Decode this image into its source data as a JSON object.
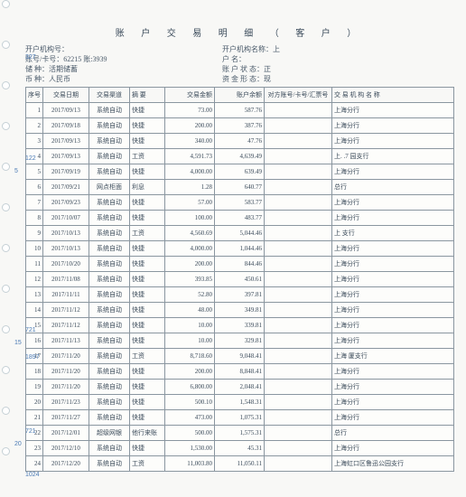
{
  "title": "账 户 交 易 明 细 （ 客 户 ）",
  "header": {
    "left": {
      "l1": "开户机构号：",
      "l2": "账号/卡号：62215          账:3939",
      "l3": "储     种：活期储蓄",
      "l4": "币     种：人民币"
    },
    "right": {
      "r1": "开户机构名称：上",
      "r2": "户         名：",
      "r3": "账 户 状 态：正",
      "r4": "资 金 形 态：现"
    }
  },
  "blue_marks": [
    "327",
    "122",
    "5",
    "721",
    "15",
    "1897",
    "721",
    "20",
    "1024"
  ],
  "columns": {
    "idx": "序号",
    "date": "交易日期",
    "qd": "交易渠道",
    "zy": "摘  要",
    "amt": "交易金额",
    "bal": "账户余额",
    "opp": "对方账号/卡号/汇票号",
    "branch": "交 易 机 构 名 称"
  },
  "rows": [
    {
      "i": "1",
      "d": "2017/09/13",
      "q": "系统自动",
      "z": "快捷",
      "a": "73.00",
      "b": "587.76",
      "o": "",
      "br": "上海分行"
    },
    {
      "i": "2",
      "d": "2017/09/18",
      "q": "系统自动",
      "z": "快捷",
      "a": "200.00",
      "b": "387.76",
      "o": "",
      "br": "上海分行"
    },
    {
      "i": "3",
      "d": "2017/09/13",
      "q": "系统自动",
      "z": "快捷",
      "a": "340.00",
      "b": "47.76",
      "o": "",
      "br": "上海分行"
    },
    {
      "i": "4",
      "d": "2017/09/13",
      "q": "系统自动",
      "z": "工资",
      "a": "4,591.73",
      "b": "4,639.49",
      "o": "",
      "br": "上.      .7  园支行"
    },
    {
      "i": "5",
      "d": "2017/09/19",
      "q": "系统自动",
      "z": "快捷",
      "a": "4,000.00",
      "b": "639.49",
      "o": "",
      "br": "上海分行"
    },
    {
      "i": "6",
      "d": "2017/09/21",
      "q": "网点柜面",
      "z": "利息",
      "a": "1.28",
      "b": "640.77",
      "o": "",
      "br": "总行"
    },
    {
      "i": "7",
      "d": "2017/09/23",
      "q": "系统自动",
      "z": "快捷",
      "a": "57.00",
      "b": "583.77",
      "o": "",
      "br": "上海分行"
    },
    {
      "i": "8",
      "d": "2017/10/07",
      "q": "系统自动",
      "z": "快捷",
      "a": "100.00",
      "b": "483.77",
      "o": "",
      "br": "上海分行"
    },
    {
      "i": "9",
      "d": "2017/10/13",
      "q": "系统自动",
      "z": "工资",
      "a": "4,560.69",
      "b": "5,044.46",
      "o": "",
      "br": "上           支行"
    },
    {
      "i": "10",
      "d": "2017/10/13",
      "q": "系统自动",
      "z": "快捷",
      "a": "4,000.00",
      "b": "1,044.46",
      "o": "",
      "br": "上海分行"
    },
    {
      "i": "11",
      "d": "2017/10/20",
      "q": "系统自动",
      "z": "快捷",
      "a": "200.00",
      "b": "844.46",
      "o": "",
      "br": "上海分行"
    },
    {
      "i": "12",
      "d": "2017/11/08",
      "q": "系统自动",
      "z": "快捷",
      "a": "393.85",
      "b": "450.61",
      "o": "",
      "br": "上海分行"
    },
    {
      "i": "13",
      "d": "2017/11/11",
      "q": "系统自动",
      "z": "快捷",
      "a": "52.80",
      "b": "397.81",
      "o": "",
      "br": "上海分行"
    },
    {
      "i": "14",
      "d": "2017/11/12",
      "q": "系统自动",
      "z": "快捷",
      "a": "48.00",
      "b": "349.81",
      "o": "",
      "br": "上海分行"
    },
    {
      "i": "15",
      "d": "2017/11/12",
      "q": "系统自动",
      "z": "快捷",
      "a": "10.00",
      "b": "339.81",
      "o": "",
      "br": "上海分行"
    },
    {
      "i": "16",
      "d": "2017/11/13",
      "q": "系统自动",
      "z": "快捷",
      "a": "10.00",
      "b": "329.81",
      "o": "",
      "br": "上海分行"
    },
    {
      "i": "17",
      "d": "2017/11/20",
      "q": "系统自动",
      "z": "工资",
      "a": "8,718.60",
      "b": "9,048.41",
      "o": "",
      "br": "上海        厦支行"
    },
    {
      "i": "18",
      "d": "2017/11/20",
      "q": "系统自动",
      "z": "快捷",
      "a": "200.00",
      "b": "8,848.41",
      "o": "",
      "br": "上海分行"
    },
    {
      "i": "19",
      "d": "2017/11/20",
      "q": "系统自动",
      "z": "快捷",
      "a": "6,800.00",
      "b": "2,048.41",
      "o": "",
      "br": "上海分行"
    },
    {
      "i": "20",
      "d": "2017/11/23",
      "q": "系统自动",
      "z": "快捷",
      "a": "500.10",
      "b": "1,548.31",
      "o": "",
      "br": "上海分行"
    },
    {
      "i": "21",
      "d": "2017/11/27",
      "q": "系统自动",
      "z": "快捷",
      "a": "473.00",
      "b": "1,075.31",
      "o": "",
      "br": "上海分行"
    },
    {
      "i": "22",
      "d": "2017/12/01",
      "q": "超级网银",
      "z": "他行来账",
      "a": "500.00",
      "b": "1,575.31",
      "o": "",
      "br": "总行"
    },
    {
      "i": "23",
      "d": "2017/12/10",
      "q": "系统自动",
      "z": "快捷",
      "a": "1,530.00",
      "b": "45.31",
      "o": "",
      "br": "上海分行"
    },
    {
      "i": "24",
      "d": "2017/12/20",
      "q": "系统自动",
      "z": "工资",
      "a": "11,003.80",
      "b": "11,050.11",
      "o": "",
      "br": "上海虹口区鲁迅公园支行"
    }
  ]
}
